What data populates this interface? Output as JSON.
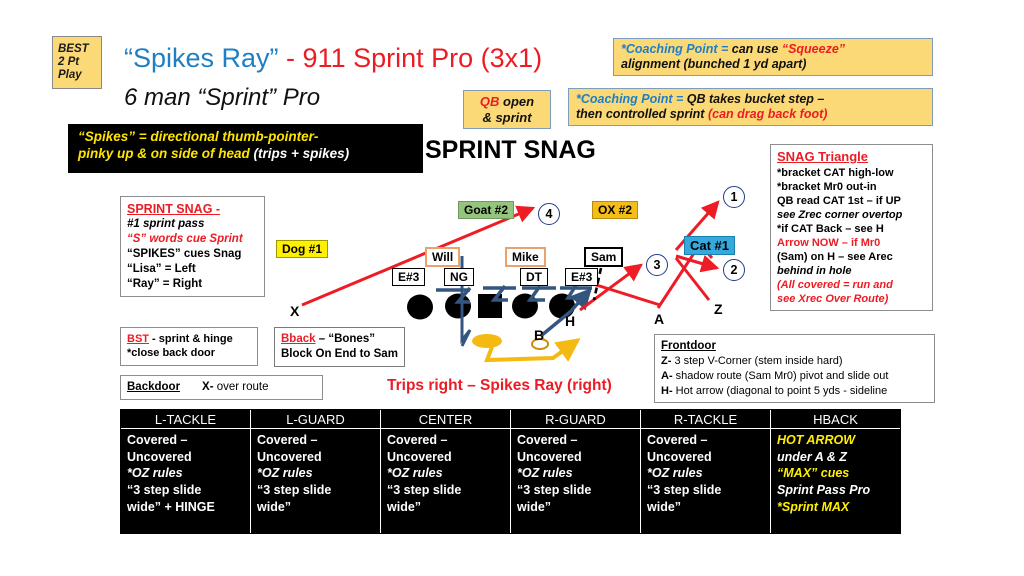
{
  "badge": {
    "line1": "BEST",
    "line2": "2 Pt",
    "line3": "Play"
  },
  "title": {
    "part_blue": "“Spikes Ray”",
    "part_red": " - 911 Sprint Pro (3x1)",
    "subtitle": "6 man “Sprint” Pro",
    "headline": "SPRINT SNAG"
  },
  "spikes_definition": {
    "line1_yellow": "“Spikes” =  directional thumb-pointer-",
    "line2_yellow": "pinky up & on side of head ",
    "line2_white": "(trips + spikes)"
  },
  "coaching_points": {
    "squeeze": {
      "label": "*Coaching Point = ",
      "text_a": "can use ",
      "highlight": "“Squeeze”",
      "text_b": "alignment (bunched 1 yd apart)"
    },
    "bucket": {
      "label": "*Coaching Point = ",
      "text_a": "QB takes bucket step –",
      "text_b": "then controlled sprint ",
      "highlight": "(can drag back foot)"
    }
  },
  "qb_open": {
    "red": "QB",
    "rest": " open",
    "line2": "& sprint"
  },
  "notes": {
    "sprint_snag": {
      "header": "SPRINT SNAG -",
      "lines": [
        "#1 sprint pass",
        "“S” words cue Sprint",
        "“SPIKES” cues Snag",
        "“Lisa” = Left",
        "“Ray” = Right"
      ]
    },
    "snag_triangle": {
      "header": "SNAG Triangle",
      "lines": [
        "*bracket CAT high-low",
        "*bracket Mr0 out-in",
        "QB read CAT 1st – if UP",
        "see Zrec corner overtop",
        "*if CAT Back – see H",
        "Arrow NOW – if  Mr0",
        "(Sam) on H – see Arec",
        "behind in hole",
        "(All covered = run and",
        "see Xrec Over Route)"
      ]
    },
    "bst": {
      "header": "BST",
      "line1": " - sprint & hinge",
      "line2": "*close back door"
    },
    "bback": {
      "header": "Bback",
      "line1": " – “Bones”",
      "line2": "Block On End to Sam"
    },
    "backdoor": {
      "header": "Backdoor",
      "body_bold": "X-",
      "body": " over route"
    },
    "frontdoor": {
      "header": "Frontdoor",
      "lines": [
        {
          "key": "Z-",
          "text": " 3 step V-Corner (stem inside hard)"
        },
        {
          "key": "A-",
          "text": " shadow route (Sam Mr0) pivot and slide out"
        },
        {
          "key": "H-",
          "text": " Hot arrow (diagonal to point 5 yds - sideline"
        }
      ]
    }
  },
  "diagram": {
    "tags": {
      "dog": "Dog #1",
      "goat": "Goat #2",
      "ox": "OX #2",
      "cat": "Cat #1",
      "will": "Will",
      "mike": "Mike",
      "sam": "Sam",
      "e3_left": "E#3",
      "ng": "NG",
      "dt": "DT",
      "e3_right": "E#3"
    },
    "receiver_letters": {
      "x": "X",
      "h": "H",
      "b": "B",
      "z": "Z",
      "a": "A"
    },
    "circled_numbers": {
      "one": "1",
      "two": "2",
      "three": "3",
      "four": "4"
    },
    "formation_caption": "Trips right – Spikes Ray (right)"
  },
  "ol_table": {
    "headers": [
      "L-TACKLE",
      "L-GUARD",
      "CENTER",
      "R-GUARD",
      "R-TACKLE",
      "HBACK"
    ],
    "columns": [
      {
        "l1": "Covered –",
        "l2": "Uncovered",
        "l3": "*OZ rules",
        "l4": "“3 step slide",
        "l5": "wide” + HINGE"
      },
      {
        "l1": "Covered –",
        "l2": "Uncovered",
        "l3": "*OZ  rules",
        "l4": "“3 step slide",
        "l5": "wide”"
      },
      {
        "l1": "Covered –",
        "l2": "Uncovered",
        "l3": "*OZ rules",
        "l4": "“3 step slide",
        "l5": "wide”"
      },
      {
        "l1": "Covered –",
        "l2": "Uncovered",
        "l3": "*OZ  rules",
        "l4": "“3 step slide",
        "l5": "wide”"
      },
      {
        "l1": "Covered –",
        "l2": "Uncovered",
        "l3": "*OZ rules",
        "l4": "“3 step slide",
        "l5": "wide”"
      },
      {
        "l1": "HOT ARROW",
        "l2": "under A & Z",
        "l3": "“MAX” cues",
        "l4": "Sprint Pass Pro",
        "l5": "*Sprint MAX"
      }
    ]
  },
  "colors": {
    "red": "#ec1c24",
    "blue": "#1f7fc4",
    "yellow": "#ffef00",
    "gold": "#fcd977",
    "route_red": "#ee1c25",
    "block_blue": "#33557f",
    "qb_yellow": "#f5b914",
    "green": "#94c47d"
  }
}
